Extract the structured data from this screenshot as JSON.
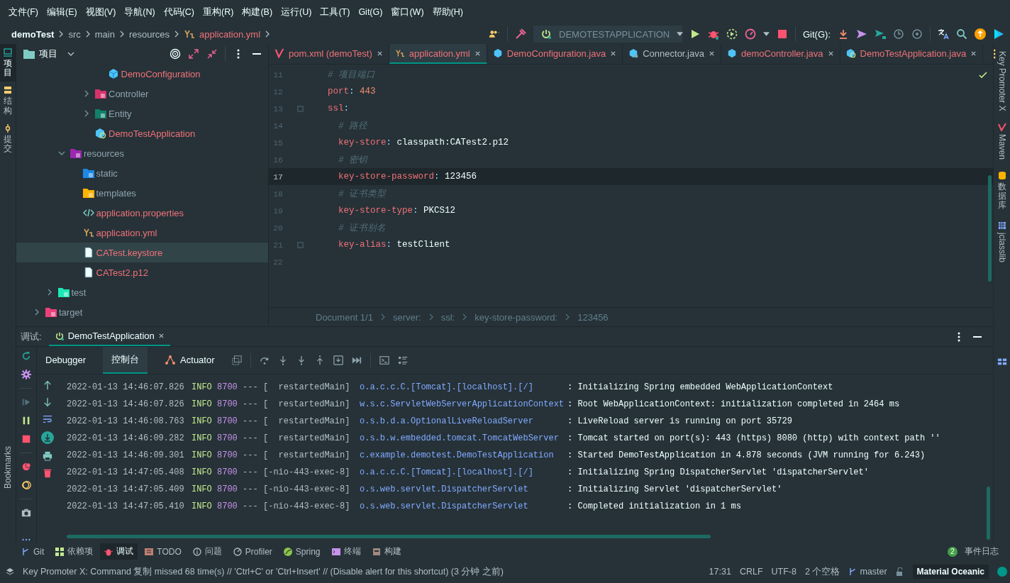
{
  "menu": [
    "文件(F)",
    "编辑(E)",
    "视图(V)",
    "导航(N)",
    "代码(C)",
    "重构(R)",
    "构建(B)",
    "运行(U)",
    "工具(T)",
    "Git(G)",
    "窗口(W)",
    "帮助(H)"
  ],
  "breadcrumb": [
    {
      "label": "demoTest",
      "kind": "project"
    },
    {
      "label": "src",
      "kind": "dir"
    },
    {
      "label": "main",
      "kind": "dir"
    },
    {
      "label": "resources",
      "kind": "dir"
    },
    {
      "label": "application.yml",
      "kind": "yaml"
    }
  ],
  "toolbar": {
    "run_config": "DEMOTESTAPPLICATION",
    "git_label": "Git(G):"
  },
  "left_strip": [
    {
      "label": "项目",
      "kind": "project",
      "selected": true
    },
    {
      "label": "结构",
      "kind": "structure",
      "selected": false
    },
    {
      "label": "提交",
      "kind": "commit",
      "selected": false
    }
  ],
  "bookmarks": "Bookmarks",
  "project": {
    "title": "项目",
    "tree": [
      {
        "children": [
          {
            "children": [
              {
                "children": [
                  {
                    "children": [
                      {
                        "children": [
                          {
                            "label": "DemoConfiguration",
                            "kind": "class",
                            "unversioned": true,
                            "selected": false
                          }
                        ]
                      },
                      {
                        "label": "Controller",
                        "kind": "controller",
                        "expanded": false,
                        "unversioned": false,
                        "selected": false
                      },
                      {
                        "label": "Entity",
                        "kind": "entity",
                        "expanded": false,
                        "unversioned": false,
                        "selected": false
                      },
                      {
                        "label": "DemoTestApplication",
                        "kind": "app",
                        "unversioned": true,
                        "selected": false
                      }
                    ]
                  }
                ]
              },
              {
                "label": "resources",
                "kind": "resources",
                "expanded": true,
                "unversioned": false,
                "selected": false,
                "children": [
                  {
                    "label": "static",
                    "kind": "static",
                    "unversioned": false,
                    "selected": false
                  },
                  {
                    "label": "templates",
                    "kind": "templates",
                    "unversioned": false,
                    "selected": false
                  },
                  {
                    "label": "application.properties",
                    "kind": "properties",
                    "unversioned": true,
                    "selected": false
                  },
                  {
                    "label": "application.yml",
                    "kind": "yaml",
                    "unversioned": true,
                    "selected": false
                  },
                  {
                    "label": "CATest.keystore",
                    "kind": "file",
                    "unversioned": true,
                    "selected": true
                  },
                  {
                    "label": "CATest2.p12",
                    "kind": "file",
                    "unversioned": true,
                    "selected": false
                  }
                ]
              }
            ]
          },
          {
            "label": "test",
            "kind": "test",
            "expanded": false,
            "unversioned": false,
            "selected": false
          }
        ]
      },
      {
        "label": "target",
        "kind": "target",
        "expanded": false,
        "unversioned": false,
        "selected": false
      }
    ]
  },
  "tabs": [
    {
      "label": "pom.xml (demoTest)",
      "kind": "maven",
      "unversioned": true,
      "selected": false
    },
    {
      "label": "application.yml",
      "kind": "yaml",
      "unversioned": true,
      "selected": true
    },
    {
      "label": "DemoConfiguration.java",
      "kind": "class",
      "unversioned": true,
      "selected": false
    },
    {
      "label": "Connector.java",
      "kind": "classfile",
      "unversioned": false,
      "selected": false
    },
    {
      "label": "demoController.java",
      "kind": "class",
      "unversioned": true,
      "selected": false
    },
    {
      "label": "DemoTestApplication.java",
      "kind": "app",
      "unversioned": true,
      "selected": false
    }
  ],
  "lines": [
    {
      "number": "11",
      "current": false,
      "fold": false,
      "tokens": [
        {
          "kind": "comment",
          "text": "  # 项目端口"
        }
      ]
    },
    {
      "number": "12",
      "current": false,
      "fold": false,
      "tokens": [
        {
          "kind": "key",
          "text": "  port"
        },
        {
          "kind": "punct",
          "text": ": "
        },
        {
          "kind": "number",
          "text": "443"
        }
      ]
    },
    {
      "number": "13",
      "current": false,
      "fold": true,
      "tokens": [
        {
          "kind": "key",
          "text": "  ssl"
        },
        {
          "kind": "punct",
          "text": ":"
        }
      ]
    },
    {
      "number": "14",
      "current": false,
      "fold": false,
      "tokens": [
        {
          "kind": "comment",
          "text": "    # 路径"
        }
      ]
    },
    {
      "number": "15",
      "current": false,
      "fold": false,
      "tokens": [
        {
          "kind": "key",
          "text": "    key-store"
        },
        {
          "kind": "punct",
          "text": ": "
        },
        {
          "kind": "string",
          "text": "classpath:CATest2.p12"
        }
      ]
    },
    {
      "number": "16",
      "current": false,
      "fold": false,
      "tokens": [
        {
          "kind": "comment",
          "text": "    # 密钥"
        }
      ]
    },
    {
      "number": "17",
      "current": true,
      "fold": false,
      "tokens": [
        {
          "kind": "key",
          "text": "    key-store-password"
        },
        {
          "kind": "punct",
          "text": ": "
        },
        {
          "kind": "string",
          "text": "123456"
        }
      ]
    },
    {
      "number": "18",
      "current": false,
      "fold": false,
      "tokens": [
        {
          "kind": "comment",
          "text": "    # 证书类型"
        }
      ]
    },
    {
      "number": "19",
      "current": false,
      "fold": false,
      "tokens": [
        {
          "kind": "key",
          "text": "    key-store-type"
        },
        {
          "kind": "punct",
          "text": ": "
        },
        {
          "kind": "string",
          "text": "PKCS12"
        }
      ]
    },
    {
      "number": "20",
      "current": false,
      "fold": false,
      "tokens": [
        {
          "kind": "comment",
          "text": "    # 证书别名"
        }
      ]
    },
    {
      "number": "21",
      "current": false,
      "fold": true,
      "tokens": [
        {
          "kind": "key",
          "text": "    key-alias"
        },
        {
          "kind": "punct",
          "text": ": "
        },
        {
          "kind": "string",
          "text": "testClient"
        }
      ]
    },
    {
      "number": "22",
      "current": false,
      "fold": false
    }
  ],
  "editor_breadcrumb": [
    "Document 1/1",
    "server:",
    "ssl:",
    "key-store-password:",
    "123456"
  ],
  "right_strip": [
    {
      "label": "Key Promoter X",
      "kind": "plugin"
    },
    {
      "label": "Maven",
      "kind": "maven"
    },
    {
      "label": "数据库",
      "kind": "database"
    },
    {
      "label": "jclasslib",
      "kind": "bytecode"
    }
  ],
  "debug": {
    "title": "调试:",
    "session": "DemoTestApplication",
    "subtabs": [
      {
        "label": "Debugger",
        "kind": "plain",
        "selected": false
      },
      {
        "label": "控制台",
        "kind": "plain",
        "selected": true
      },
      {
        "label": "Actuator",
        "kind": "actuator",
        "selected": false
      }
    ],
    "log": [
      {
        "time": "2022-01-13 14:46:07.826",
        "level": "INFO",
        "pid": "8700",
        "sep": "---",
        "thread": "[  restartedMain]",
        "logger": "o.a.c.c.C.[Tomcat].[localhost].[/]",
        "message": ": Initializing Spring embedded WebApplicationContext"
      },
      {
        "time": "2022-01-13 14:46:07.826",
        "level": "INFO",
        "pid": "8700",
        "sep": "---",
        "thread": "[  restartedMain]",
        "logger": "w.s.c.ServletWebServerApplicationContext",
        "message": ": Root WebApplicationContext: initialization completed in 2464 ms"
      },
      {
        "time": "2022-01-13 14:46:08.763",
        "level": "INFO",
        "pid": "8700",
        "sep": "---",
        "thread": "[  restartedMain]",
        "logger": "o.s.b.d.a.OptionalLiveReloadServer",
        "message": ": LiveReload server is running on port 35729"
      },
      {
        "time": "2022-01-13 14:46:09.282",
        "level": "INFO",
        "pid": "8700",
        "sep": "---",
        "thread": "[  restartedMain]",
        "logger": "o.s.b.w.embedded.tomcat.TomcatWebServer",
        "message": ": Tomcat started on port(s): 443 (https) 8080 (http) with context path ''"
      },
      {
        "time": "2022-01-13 14:46:09.301",
        "level": "INFO",
        "pid": "8700",
        "sep": "---",
        "thread": "[  restartedMain]",
        "logger": "c.example.demotest.DemoTestApplication",
        "message": ": Started DemoTestApplication in 4.878 seconds (JVM running for 6.243)"
      },
      {
        "time": "2022-01-13 14:47:05.408",
        "level": "INFO",
        "pid": "8700",
        "sep": "---",
        "thread": "[-nio-443-exec-8]",
        "logger": "o.a.c.c.C.[Tomcat].[localhost].[/]",
        "message": ": Initializing Spring DispatcherServlet 'dispatcherServlet'"
      },
      {
        "time": "2022-01-13 14:47:05.409",
        "level": "INFO",
        "pid": "8700",
        "sep": "---",
        "thread": "[-nio-443-exec-8]",
        "logger": "o.s.web.servlet.DispatcherServlet",
        "message": ": Initializing Servlet 'dispatcherServlet'"
      },
      {
        "time": "2022-01-13 14:47:05.410",
        "level": "INFO",
        "pid": "8700",
        "sep": "---",
        "thread": "[-nio-443-exec-8]",
        "logger": "o.s.web.servlet.DispatcherServlet",
        "message": ": Completed initialization in 1 ms"
      }
    ]
  },
  "tool_windows": [
    {
      "label": "Git",
      "kind": "git",
      "selected": false
    },
    {
      "label": "依赖项",
      "kind": "dependencies",
      "selected": false
    },
    {
      "label": "调试",
      "kind": "debug",
      "selected": true
    },
    {
      "label": "TODO",
      "kind": "todo",
      "selected": false
    },
    {
      "label": "问题",
      "kind": "problems",
      "selected": false
    },
    {
      "label": "Profiler",
      "kind": "profiler",
      "selected": false
    },
    {
      "label": "Spring",
      "kind": "spring",
      "selected": false
    },
    {
      "label": "终端",
      "kind": "terminal",
      "selected": false
    },
    {
      "label": "构建",
      "kind": "build",
      "selected": false
    }
  ],
  "event_log": {
    "count": "2",
    "label": "事件日志"
  },
  "status": {
    "message": "Key Promoter X: Command 复制 missed 68 time(s) // 'Ctrl+C' or 'Ctrl+Insert' // (Disable alert for this shortcut) (3 分钟 之前)",
    "position": "17:31",
    "line_ending": "CRLF",
    "encoding": "UTF-8",
    "indent": "2 个空格",
    "branch": "master",
    "theme": "Material Oceanic"
  }
}
